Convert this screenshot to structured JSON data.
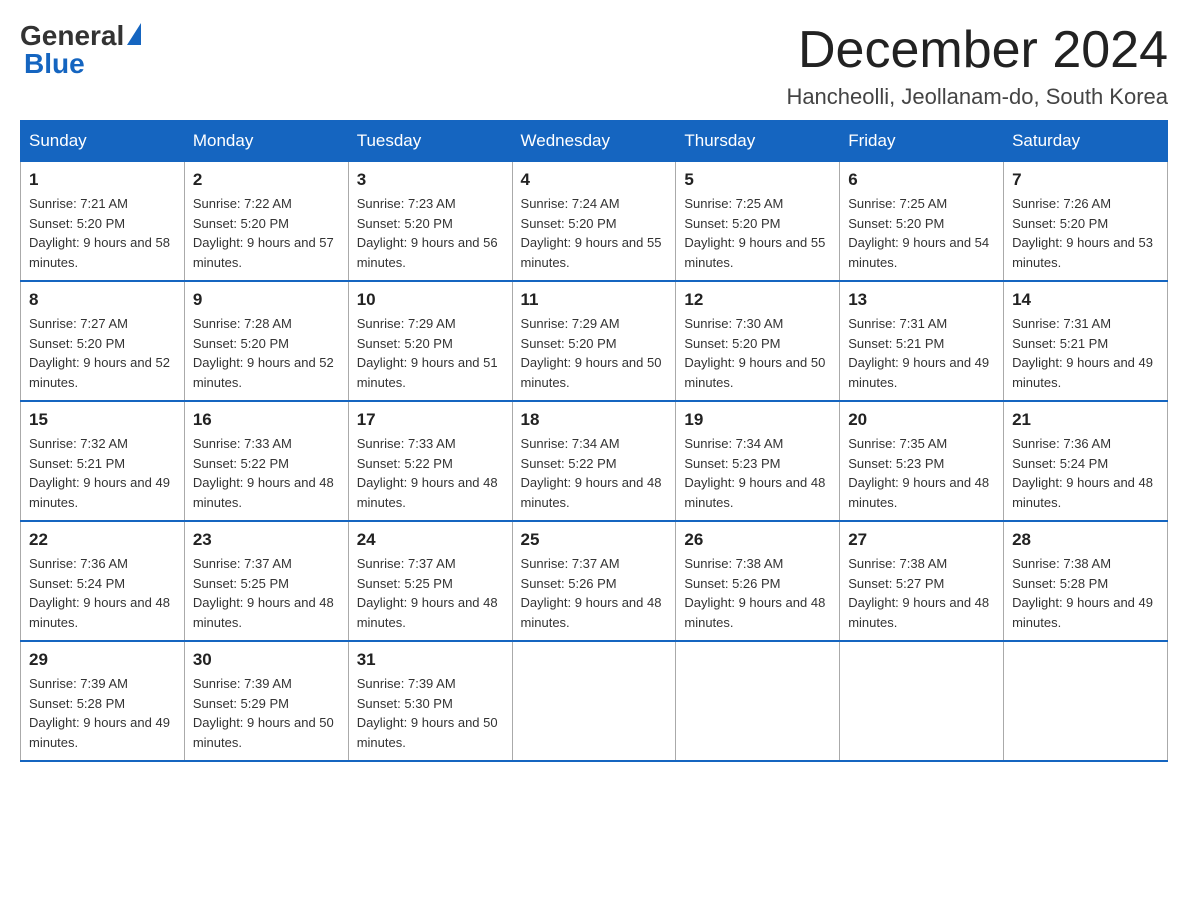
{
  "logo": {
    "general": "General",
    "blue": "Blue"
  },
  "title": "December 2024",
  "subtitle": "Hancheolli, Jeollanam-do, South Korea",
  "days": [
    "Sunday",
    "Monday",
    "Tuesday",
    "Wednesday",
    "Thursday",
    "Friday",
    "Saturday"
  ],
  "weeks": [
    [
      {
        "num": "1",
        "sunrise": "7:21 AM",
        "sunset": "5:20 PM",
        "daylight": "9 hours and 58 minutes."
      },
      {
        "num": "2",
        "sunrise": "7:22 AM",
        "sunset": "5:20 PM",
        "daylight": "9 hours and 57 minutes."
      },
      {
        "num": "3",
        "sunrise": "7:23 AM",
        "sunset": "5:20 PM",
        "daylight": "9 hours and 56 minutes."
      },
      {
        "num": "4",
        "sunrise": "7:24 AM",
        "sunset": "5:20 PM",
        "daylight": "9 hours and 55 minutes."
      },
      {
        "num": "5",
        "sunrise": "7:25 AM",
        "sunset": "5:20 PM",
        "daylight": "9 hours and 55 minutes."
      },
      {
        "num": "6",
        "sunrise": "7:25 AM",
        "sunset": "5:20 PM",
        "daylight": "9 hours and 54 minutes."
      },
      {
        "num": "7",
        "sunrise": "7:26 AM",
        "sunset": "5:20 PM",
        "daylight": "9 hours and 53 minutes."
      }
    ],
    [
      {
        "num": "8",
        "sunrise": "7:27 AM",
        "sunset": "5:20 PM",
        "daylight": "9 hours and 52 minutes."
      },
      {
        "num": "9",
        "sunrise": "7:28 AM",
        "sunset": "5:20 PM",
        "daylight": "9 hours and 52 minutes."
      },
      {
        "num": "10",
        "sunrise": "7:29 AM",
        "sunset": "5:20 PM",
        "daylight": "9 hours and 51 minutes."
      },
      {
        "num": "11",
        "sunrise": "7:29 AM",
        "sunset": "5:20 PM",
        "daylight": "9 hours and 50 minutes."
      },
      {
        "num": "12",
        "sunrise": "7:30 AM",
        "sunset": "5:20 PM",
        "daylight": "9 hours and 50 minutes."
      },
      {
        "num": "13",
        "sunrise": "7:31 AM",
        "sunset": "5:21 PM",
        "daylight": "9 hours and 49 minutes."
      },
      {
        "num": "14",
        "sunrise": "7:31 AM",
        "sunset": "5:21 PM",
        "daylight": "9 hours and 49 minutes."
      }
    ],
    [
      {
        "num": "15",
        "sunrise": "7:32 AM",
        "sunset": "5:21 PM",
        "daylight": "9 hours and 49 minutes."
      },
      {
        "num": "16",
        "sunrise": "7:33 AM",
        "sunset": "5:22 PM",
        "daylight": "9 hours and 48 minutes."
      },
      {
        "num": "17",
        "sunrise": "7:33 AM",
        "sunset": "5:22 PM",
        "daylight": "9 hours and 48 minutes."
      },
      {
        "num": "18",
        "sunrise": "7:34 AM",
        "sunset": "5:22 PM",
        "daylight": "9 hours and 48 minutes."
      },
      {
        "num": "19",
        "sunrise": "7:34 AM",
        "sunset": "5:23 PM",
        "daylight": "9 hours and 48 minutes."
      },
      {
        "num": "20",
        "sunrise": "7:35 AM",
        "sunset": "5:23 PM",
        "daylight": "9 hours and 48 minutes."
      },
      {
        "num": "21",
        "sunrise": "7:36 AM",
        "sunset": "5:24 PM",
        "daylight": "9 hours and 48 minutes."
      }
    ],
    [
      {
        "num": "22",
        "sunrise": "7:36 AM",
        "sunset": "5:24 PM",
        "daylight": "9 hours and 48 minutes."
      },
      {
        "num": "23",
        "sunrise": "7:37 AM",
        "sunset": "5:25 PM",
        "daylight": "9 hours and 48 minutes."
      },
      {
        "num": "24",
        "sunrise": "7:37 AM",
        "sunset": "5:25 PM",
        "daylight": "9 hours and 48 minutes."
      },
      {
        "num": "25",
        "sunrise": "7:37 AM",
        "sunset": "5:26 PM",
        "daylight": "9 hours and 48 minutes."
      },
      {
        "num": "26",
        "sunrise": "7:38 AM",
        "sunset": "5:26 PM",
        "daylight": "9 hours and 48 minutes."
      },
      {
        "num": "27",
        "sunrise": "7:38 AM",
        "sunset": "5:27 PM",
        "daylight": "9 hours and 48 minutes."
      },
      {
        "num": "28",
        "sunrise": "7:38 AM",
        "sunset": "5:28 PM",
        "daylight": "9 hours and 49 minutes."
      }
    ],
    [
      {
        "num": "29",
        "sunrise": "7:39 AM",
        "sunset": "5:28 PM",
        "daylight": "9 hours and 49 minutes."
      },
      {
        "num": "30",
        "sunrise": "7:39 AM",
        "sunset": "5:29 PM",
        "daylight": "9 hours and 50 minutes."
      },
      {
        "num": "31",
        "sunrise": "7:39 AM",
        "sunset": "5:30 PM",
        "daylight": "9 hours and 50 minutes."
      },
      null,
      null,
      null,
      null
    ]
  ]
}
